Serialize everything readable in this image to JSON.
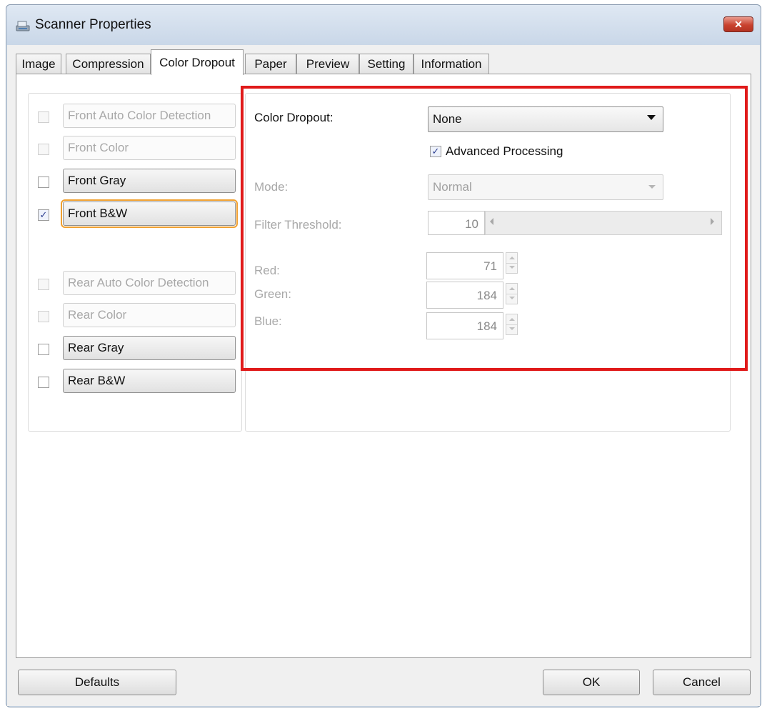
{
  "window": {
    "title": "Scanner Properties",
    "close_symbol": "✕"
  },
  "tabs": [
    "Image",
    "Compression",
    "Color Dropout",
    "Paper",
    "Preview",
    "Setting",
    "Information"
  ],
  "active_tab": "Color Dropout",
  "left_panel": {
    "items": [
      {
        "label": "Front Auto Color Detection",
        "checked": false,
        "enabled": false
      },
      {
        "label": "Front Color",
        "checked": false,
        "enabled": false
      },
      {
        "label": "Front Gray",
        "checked": false,
        "enabled": true
      },
      {
        "label": "Front B&W",
        "checked": true,
        "enabled": true,
        "focused": true
      },
      {
        "label": "Rear Auto Color Detection",
        "checked": false,
        "enabled": false
      },
      {
        "label": "Rear Color",
        "checked": false,
        "enabled": false
      },
      {
        "label": "Rear Gray",
        "checked": false,
        "enabled": true
      },
      {
        "label": "Rear B&W",
        "checked": false,
        "enabled": true
      }
    ],
    "check_mark": "✓"
  },
  "settings": {
    "color_dropout_label": "Color Dropout:",
    "color_dropout_value": "None",
    "advanced_processing_label": "Advanced Processing",
    "advanced_processing_checked": true,
    "mode_label": "Mode:",
    "mode_value": "Normal",
    "filter_threshold_label": "Filter Threshold:",
    "filter_threshold_value": "10",
    "red_label": "Red:",
    "red_value": "71",
    "green_label": "Green:",
    "green_value": "184",
    "blue_label": "Blue:",
    "blue_value": "184"
  },
  "footer": {
    "defaults": "Defaults",
    "ok": "OK",
    "cancel": "Cancel"
  },
  "colors": {
    "highlight": "#e01a1a",
    "focus": "#f0a030",
    "close_button": "#c9422f"
  }
}
